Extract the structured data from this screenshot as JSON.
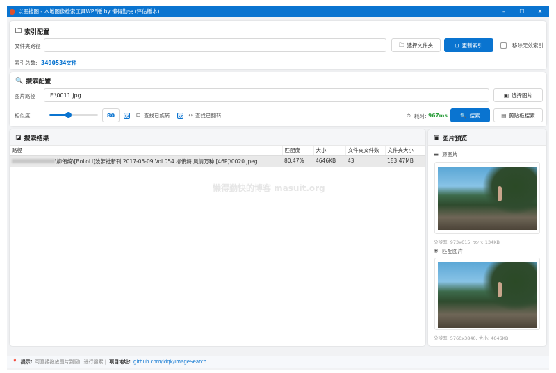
{
  "window": {
    "title": "以图搜图 - 本地图像检索工具WPF版 by 懒得勤快 (评估版本)",
    "minimize": "–",
    "maximize": "☐",
    "close": "✕"
  },
  "index": {
    "heading": "索引配置",
    "folder_label": "文件夹路径",
    "folder_value": "",
    "select_folder": "选择文件夹",
    "update_index": "更新索引",
    "remove_invalid": "移除无效索引",
    "total_label": "索引总数:",
    "total_value": "3490534文件"
  },
  "search": {
    "heading": "搜索配置",
    "image_label": "图片路径",
    "image_value": "F:\\0011.jpg",
    "select_image": "选择图片",
    "similarity_label": "相似度",
    "similarity_value": "80",
    "similarity_percent": 80,
    "find_rotated": "查找已旋转",
    "find_rotated_checked": true,
    "find_flipped": "查找已翻转",
    "find_flipped_checked": true,
    "elapsed_label": "耗时:",
    "elapsed_value": "967ms",
    "search_button": "搜索",
    "paste_search": "剪贴板搜索"
  },
  "results": {
    "heading": "搜索结果",
    "columns": [
      "路径",
      "匹配度",
      "大小",
      "文件夹文件数",
      "文件夹大小"
    ],
    "rows": [
      {
        "path": "\\柳侑绮\\[BoLoLi]波萝社新刊 2017-05-09 Vol.054 柳侑绮 风情万种 [46P]\\0020.jpeg",
        "match": "80.47%",
        "size": "4646KB",
        "folder_count": "43",
        "folder_size": "183.47MB"
      }
    ],
    "watermark": "懒得勤快的博客 masuit.org"
  },
  "preview": {
    "heading": "图片预览",
    "source_label": "源图片",
    "source_info": "分辨率: 973x615, 大小: 134KB",
    "match_label": "匹配图片",
    "match_info": "分辨率: 5760x3840, 大小: 4646KB"
  },
  "status": {
    "tip_label": "提示:",
    "tip_text": "可直接拖放图片到窗口进行搜索 |",
    "project_label": "项目地址:",
    "project_link": "github.com/ldqk/ImageSearch"
  },
  "colors": {
    "accent": "#0a74d0",
    "elapsed": "#2a9d3a"
  }
}
